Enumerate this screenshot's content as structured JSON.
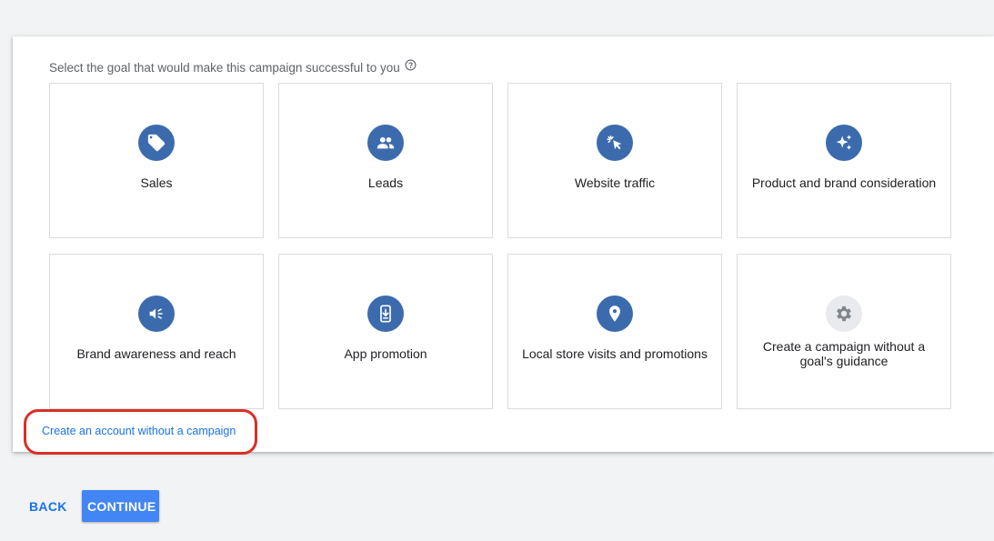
{
  "prompt": {
    "text": "Select the goal that would make this campaign successful to you",
    "help_icon": "help-circle-icon"
  },
  "goals": [
    {
      "label": "Sales",
      "icon": "tag-icon"
    },
    {
      "label": "Leads",
      "icon": "people-icon"
    },
    {
      "label": "Website traffic",
      "icon": "cursor-click-icon"
    },
    {
      "label": "Product and brand consideration",
      "icon": "sparkle-icon"
    },
    {
      "label": "Brand awareness and reach",
      "icon": "megaphone-icon"
    },
    {
      "label": "App promotion",
      "icon": "phone-download-icon"
    },
    {
      "label": "Local store visits and promotions",
      "icon": "location-pin-icon"
    },
    {
      "label": "Create a campaign without a goal's guidance",
      "icon": "gear-icon"
    }
  ],
  "account_link": "Create an account without a campaign",
  "footer": {
    "back_label": "BACK",
    "continue_label": "CONTINUE"
  },
  "colors": {
    "icon_blue": "#3c6bad",
    "link_blue": "#1a73e8",
    "button_blue": "#4285f4",
    "highlight_red": "#d93025",
    "icon_grey_bg": "#e8eaed"
  }
}
